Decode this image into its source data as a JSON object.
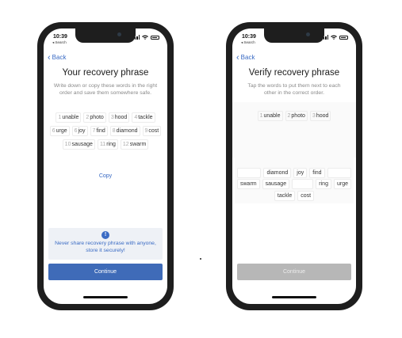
{
  "status": {
    "time": "10:39",
    "back_app": "◂ Search"
  },
  "left_screen": {
    "back_label": "Back",
    "title": "Your recovery phrase",
    "subtitle": "Write down or copy these words in the right order and save them somewhere safe.",
    "words": [
      {
        "num": "1",
        "word": "unable"
      },
      {
        "num": "2",
        "word": "photo"
      },
      {
        "num": "3",
        "word": "hood"
      },
      {
        "num": "4",
        "word": "tackle"
      },
      {
        "num": "6",
        "word": "urge"
      },
      {
        "num": "6",
        "word": "joy"
      },
      {
        "num": "7",
        "word": "find"
      },
      {
        "num": "8",
        "word": "diamond"
      },
      {
        "num": "9",
        "word": "cost"
      },
      {
        "num": "10",
        "word": "sausage"
      },
      {
        "num": "11",
        "word": "ring"
      },
      {
        "num": "12",
        "word": "swarm"
      }
    ],
    "copy_label": "Copy",
    "warning_icon": "!",
    "warning_text": "Never share recovery phrase with anyone, store it securely!",
    "continue_label": "Continue"
  },
  "right_screen": {
    "back_label": "Back",
    "title": "Verify recovery phrase",
    "subtitle": "Tap the words to put them next to each other in the correct order.",
    "selected": [
      {
        "num": "1",
        "word": "unable"
      },
      {
        "num": "2",
        "word": "photo"
      },
      {
        "num": "3",
        "word": "hood"
      }
    ],
    "pool_row1": [
      "",
      "diamond",
      "joy",
      "find",
      ""
    ],
    "pool_row2": [
      "swarm",
      "sausage",
      "",
      "ring",
      "urge"
    ],
    "pool_row3": [
      "tackle",
      "cost"
    ],
    "continue_label": "Continue"
  },
  "colors": {
    "accent": "#3f6bb8",
    "link": "#3a6bc4",
    "disabled": "#b7b7b7"
  },
  "icons": {
    "back": "chevron-left-icon",
    "warning": "exclamation-circle-icon"
  }
}
